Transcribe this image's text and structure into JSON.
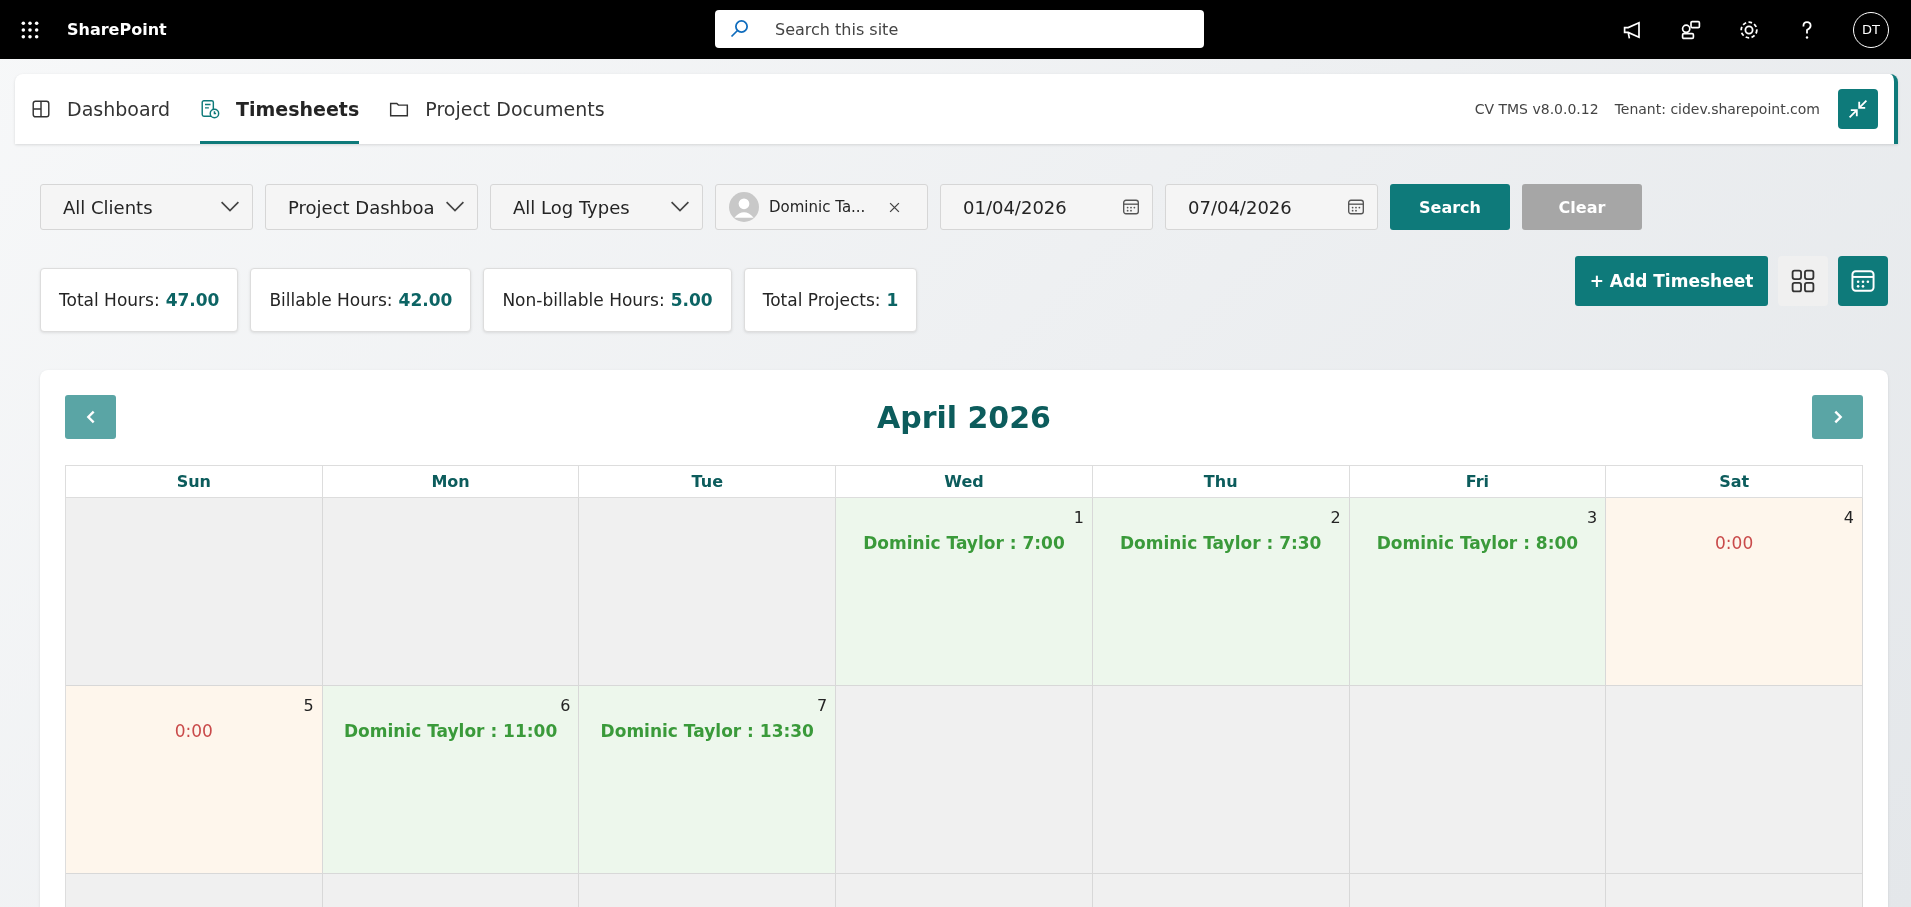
{
  "suite_bar": {
    "app_name": "SharePoint",
    "search": {
      "placeholder": "Search this site"
    },
    "avatar_initials": "DT"
  },
  "tabs": [
    {
      "label": "Dashboard",
      "selected": false,
      "kind": "dashboard"
    },
    {
      "label": "Timesheets",
      "selected": true,
      "kind": "timesheet"
    },
    {
      "label": "Project Documents",
      "selected": false,
      "kind": "folder"
    }
  ],
  "version": "CV TMS v8.0.0.12",
  "tenant": "Tenant: cidev.sharepoint.com",
  "filters": [
    {
      "kind": "dropdown",
      "value": "All Clients"
    },
    {
      "kind": "dropdown",
      "value": "Project Dashboa"
    },
    {
      "kind": "dropdown",
      "value": "All Log Types"
    },
    {
      "kind": "person",
      "value": "Dominic Ta..."
    },
    {
      "kind": "date",
      "value": "01/04/2026"
    },
    {
      "kind": "date",
      "value": "07/04/2026"
    }
  ],
  "search_button": "Search",
  "clear_button": {
    "label": "Clear",
    "disabled": true
  },
  "stats": [
    {
      "label": "Total Hours:",
      "value": "47.00"
    },
    {
      "label": "Billable Hours:",
      "value": "42.00"
    },
    {
      "label": "Non-billable Hours:",
      "value": "5.00"
    },
    {
      "label": "Total Projects:",
      "value": "1"
    }
  ],
  "add_button": "+ Add Timesheet",
  "views": [
    {
      "kind": "grid",
      "selected": false
    },
    {
      "kind": "calendar",
      "selected": true
    }
  ],
  "calendar": {
    "title": "April 2026",
    "weekdays": [
      "Sun",
      "Mon",
      "Tue",
      "Wed",
      "Thu",
      "Fri",
      "Sat"
    ],
    "weeks": [
      [
        {
          "kind": "empty"
        },
        {
          "kind": "empty"
        },
        {
          "kind": "empty"
        },
        {
          "kind": "logged",
          "day": "1",
          "entry": "Dominic Taylor : 7:00"
        },
        {
          "kind": "logged",
          "day": "2",
          "entry": "Dominic Taylor : 7:30"
        },
        {
          "kind": "logged",
          "day": "3",
          "entry": "Dominic Taylor : 8:00"
        },
        {
          "kind": "zero",
          "day": "4",
          "entry": "0:00"
        }
      ],
      [
        {
          "kind": "zero",
          "day": "5",
          "entry": "0:00"
        },
        {
          "kind": "logged",
          "day": "6",
          "entry": "Dominic Taylor : 11:00"
        },
        {
          "kind": "logged",
          "day": "7",
          "entry": "Dominic Taylor : 13:30"
        },
        {
          "kind": "empty"
        },
        {
          "kind": "empty"
        },
        {
          "kind": "empty"
        },
        {
          "kind": "empty"
        }
      ],
      [
        {
          "kind": "empty"
        },
        {
          "kind": "empty"
        },
        {
          "kind": "empty"
        },
        {
          "kind": "empty"
        },
        {
          "kind": "empty"
        },
        {
          "kind": "empty"
        },
        {
          "kind": "empty"
        }
      ]
    ]
  }
}
